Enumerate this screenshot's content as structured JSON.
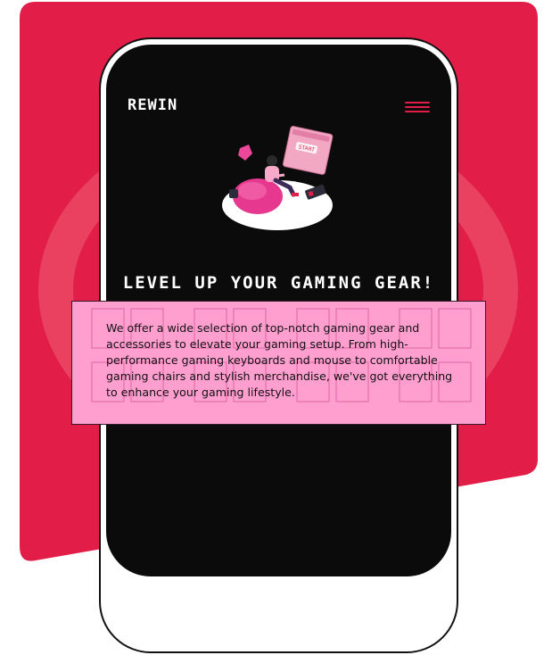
{
  "brand": {
    "logo_text": "REWIN"
  },
  "menu": {
    "icon": "hamburger-menu-icon"
  },
  "hero": {
    "illustration": "gamer-on-beanbag-illustration",
    "screen_label": "START",
    "headline": "LEVEL UP YOUR GAMING GEAR!",
    "description": "We offer a wide selection of top-notch gaming gear and accessories to elevate your gaming setup. From high-performance gaming keyboards and mouse to comfortable gaming chairs and stylish merchandise, we've got everything to enhance your gaming lifestyle."
  },
  "colors": {
    "accent": "#e11d48",
    "screen_bg": "#0b0b0b",
    "desc_bg": "#ff9fd0",
    "pink": "#ec4899"
  }
}
